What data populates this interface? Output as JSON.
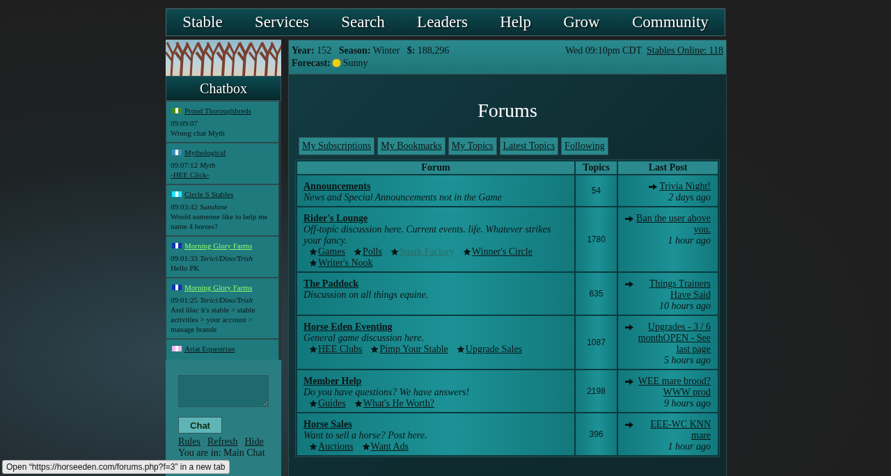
{
  "nav": [
    {
      "label": "Stable"
    },
    {
      "label": "Services"
    },
    {
      "label": "Search"
    },
    {
      "label": "Leaders"
    },
    {
      "label": "Help"
    },
    {
      "label": "Grow"
    },
    {
      "label": "Community"
    }
  ],
  "chatbox": {
    "title": "Chatbox",
    "messages": [
      {
        "stable": "Proud Thoroughbreds",
        "color": "#4a8a1a",
        "highlighted": false,
        "time": "09:09:07",
        "text": "Wrong chat Myth",
        "text_link": false
      },
      {
        "stable": "Mythological",
        "color": "#3d8fb5",
        "highlighted": false,
        "time": "09:07:12",
        "author": "Myth",
        "text": "-HEE Click-",
        "text_link": true
      },
      {
        "stable": "Circle S Stables",
        "color": "#22e8ff",
        "highlighted": false,
        "time": "09:03:42",
        "author": "Sunshine",
        "text": "Would someone like to help me name 4 horses?",
        "text_link": false
      },
      {
        "stable": "Morning Glory Farms",
        "color": "#1030b0",
        "highlighted": true,
        "time": "09:01:33",
        "author": "Terici/Dino/Trish",
        "text": "Hello PK",
        "text_link": false
      },
      {
        "stable": "Morning Glory Farms",
        "color": "#1030b0",
        "highlighted": true,
        "time": "09:01:25",
        "author": "Terici/Dino/Trish",
        "text": "And lilac it's stable > stable activities > your account > manage brands",
        "text_link": false
      },
      {
        "stable": "Ariat Equestrian",
        "color": "#f4b8ec",
        "highlighted": false
      }
    ],
    "send_button": "Chat",
    "links": [
      "Rules",
      "Refresh",
      "Hide"
    ],
    "room": "You are in: Main Chat"
  },
  "info": {
    "year_label": "Year:",
    "year": "152",
    "season_label": "Season:",
    "season": "Winter",
    "money_label": "$:",
    "money": "188,296",
    "forecast_label": "Forecast:",
    "forecast": "Sunny",
    "clock": "Wed 09:10pm CDT",
    "online": "Stables Online: 118"
  },
  "page_title": "Forums",
  "tabs": [
    {
      "label": "My Subscriptions"
    },
    {
      "label": "My Bookmarks"
    },
    {
      "label": "My Topics"
    },
    {
      "label": "Latest Topics"
    },
    {
      "label": "Following"
    }
  ],
  "table": {
    "columns": [
      "Forum",
      "Topics",
      "Last Post"
    ],
    "rows": [
      {
        "forum": "Announcements",
        "description": "News and Special Announcements not in the Game",
        "subforums": [],
        "topics": "54",
        "last_post": "Trivia Night!",
        "last_time": "2 days ago"
      },
      {
        "forum": "Rider's Lounge",
        "description": "Off-topic discussion here. Current events. life. Whatever strikes your fancy.",
        "subforums": [
          {
            "label": "Games",
            "visited": false
          },
          {
            "label": "Polls",
            "visited": false
          },
          {
            "label": "Snark Factory",
            "visited": true
          },
          {
            "label": "Winner's Circle",
            "visited": false
          },
          {
            "label": "Writer's Nook",
            "visited": false
          }
        ],
        "topics": "1780",
        "last_post": "Ban the user above you.",
        "last_time": "1 hour ago"
      },
      {
        "forum": "The Paddock",
        "description": "Discussion on all things equine.",
        "subforums": [],
        "topics": "635",
        "last_post": "Things Trainers Have Said",
        "last_time": "10 hours ago"
      },
      {
        "forum": "Horse Eden Eventing",
        "description": "General game discussion here.",
        "subforums": [
          {
            "label": "HEE Clubs",
            "visited": false
          },
          {
            "label": "Pimp Your Stable",
            "visited": false
          },
          {
            "label": "Upgrade Sales",
            "visited": false
          }
        ],
        "topics": "1087",
        "last_post": "Upgrades - 3 / 6 monthOPEN - See last page",
        "last_time": "5 hours ago"
      },
      {
        "forum": "Member Help",
        "description": "Do you have questions? We have answers!",
        "subforums": [
          {
            "label": "Guides",
            "visited": false
          },
          {
            "label": "What's He Worth?",
            "visited": false
          }
        ],
        "topics": "2198",
        "last_post": "WEE mare brood? WWW prod",
        "last_time": "9 hours ago"
      },
      {
        "forum": "Horse Sales",
        "description": "Want to sell a horse? Post here.",
        "subforums": [
          {
            "label": "Auctions",
            "visited": false
          },
          {
            "label": "Want Ads",
            "visited": false
          }
        ],
        "topics": "396",
        "last_post": "EEE-WC KNN mare",
        "last_time": "1 hour ago"
      }
    ]
  },
  "link_tooltip": "Open “https://horseeden.com/forums.php?f=3” in a new tab"
}
